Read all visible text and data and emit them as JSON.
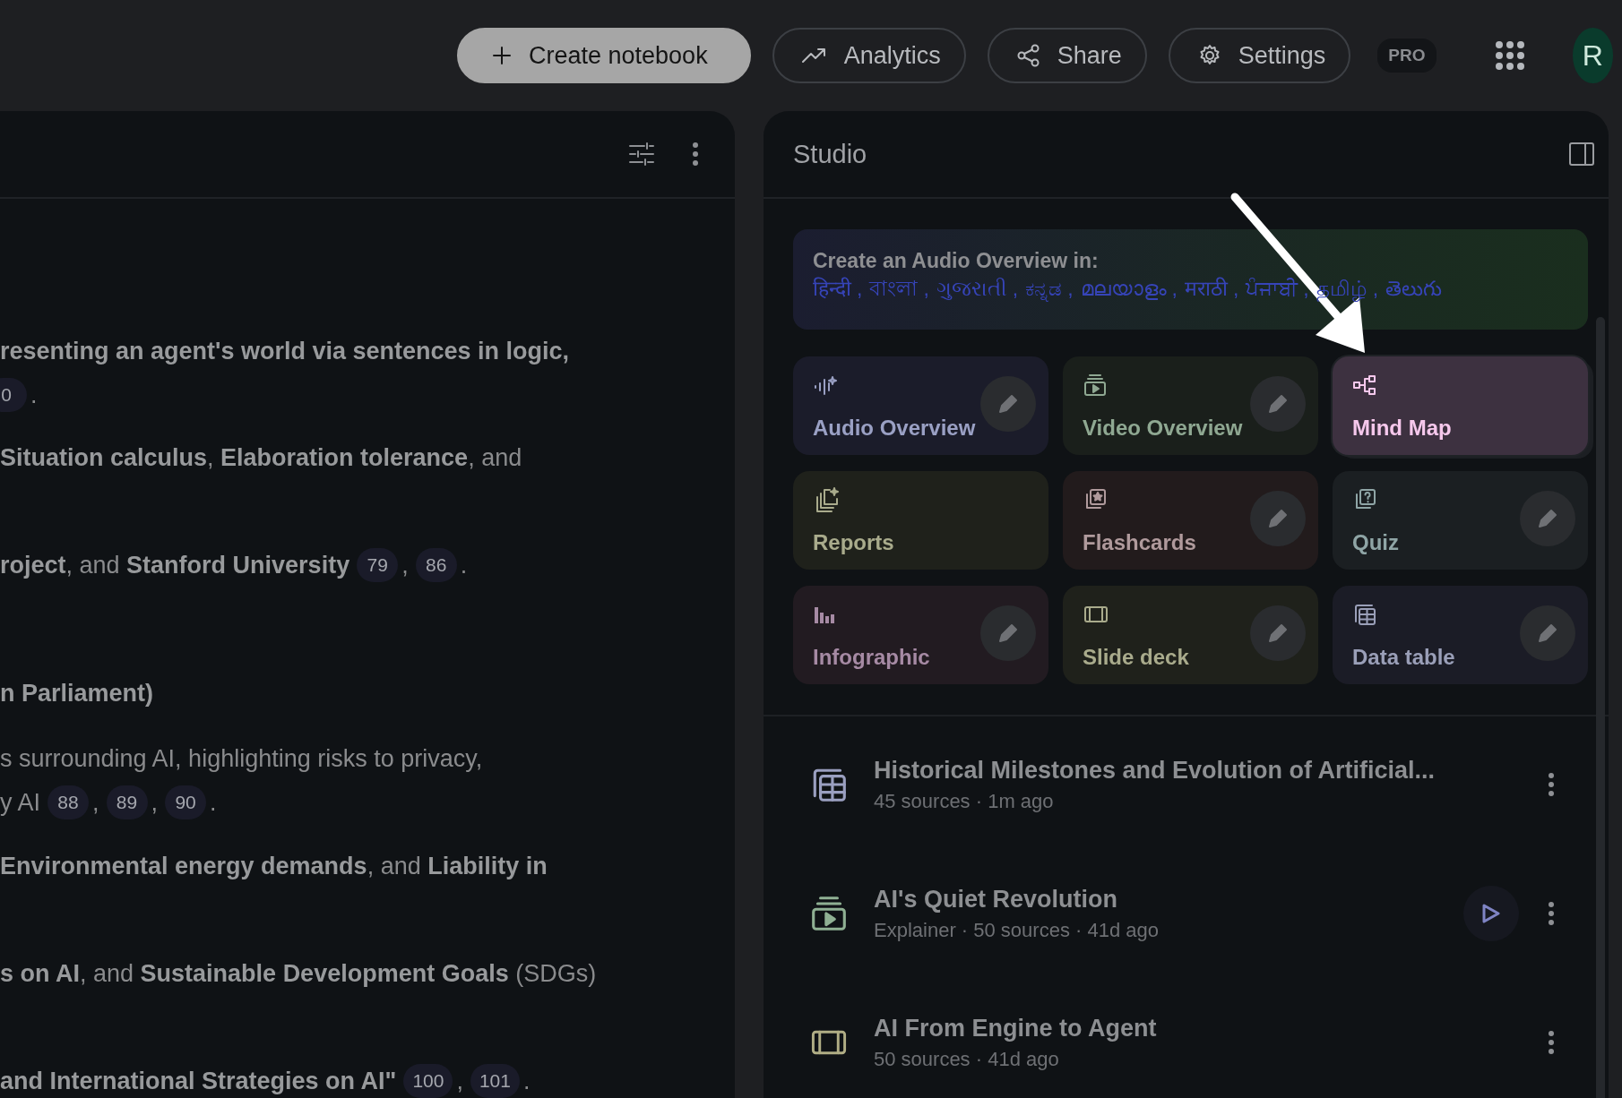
{
  "top_bar": {
    "buttons": [
      {
        "kind": "create",
        "label": "Create notebook"
      },
      {
        "kind": "analytics",
        "label": "Analytics"
      },
      {
        "kind": "share",
        "label": "Share"
      },
      {
        "kind": "settings",
        "label": "Settings"
      }
    ],
    "badge": "PRO",
    "avatar": "R"
  },
  "source_panel": {
    "lines": [
      {
        "segments": [
          {
            "kind": "text",
            "text": "**resenting an agent's world via sentences in logic,**"
          }
        ]
      },
      {
        "segments": [
          {
            "kind": "citation",
            "text": "0"
          },
          {
            "kind": "text",
            "text": "."
          }
        ]
      },
      {
        "segments": [
          {
            "kind": "text",
            "text": "**Situation calculus**, **Elaboration tolerance**, and"
          }
        ]
      },
      {
        "segments": [
          {
            "kind": "text",
            "text": "**roject**, and **Stanford University**"
          },
          {
            "kind": "citation",
            "text": "79"
          },
          {
            "kind": "text",
            "text": ","
          },
          {
            "kind": "citation",
            "text": "86"
          },
          {
            "kind": "text",
            "text": "."
          }
        ]
      },
      {
        "segments": [
          {
            "kind": "text",
            "text": "**n Parliament)**"
          }
        ]
      },
      {
        "segments": [
          {
            "kind": "text",
            "text": "s surrounding AI, highlighting risks to privacy,"
          }
        ]
      },
      {
        "segments": [
          {
            "kind": "text",
            "text": "y AI"
          },
          {
            "kind": "citation",
            "text": "88"
          },
          {
            "kind": "text",
            "text": ","
          },
          {
            "kind": "citation",
            "text": "89"
          },
          {
            "kind": "text",
            "text": ","
          },
          {
            "kind": "citation",
            "text": "90"
          },
          {
            "kind": "text",
            "text": "."
          }
        ]
      },
      {
        "segments": [
          {
            "kind": "text",
            "text": "**Environmental energy demands**, and **Liability in**"
          }
        ]
      },
      {
        "segments": [
          {
            "kind": "text",
            "text": "**s on AI**, and **Sustainable Development Goals** (SDGs)"
          }
        ]
      },
      {
        "segments": [
          {
            "kind": "text",
            "text": "**and International Strategies on AI\"**"
          },
          {
            "kind": "citation",
            "text": "100"
          },
          {
            "kind": "text",
            "text": ","
          },
          {
            "kind": "citation",
            "text": "101"
          },
          {
            "kind": "text",
            "text": "."
          }
        ]
      }
    ]
  },
  "studio": {
    "title": "Studio",
    "banner": {
      "prefix": "Create an Audio Overview in:",
      "items": [
        {
          "kind": "language",
          "text": "हिन्दी"
        },
        {
          "kind": "separator",
          "text": ","
        },
        {
          "kind": "language",
          "text": "বাংলা"
        },
        {
          "kind": "separator",
          "text": ","
        },
        {
          "kind": "language",
          "text": "ગુજરાતી"
        },
        {
          "kind": "separator",
          "text": ","
        },
        {
          "kind": "language",
          "text": "ಕನ್ನಡ"
        },
        {
          "kind": "separator",
          "text": ","
        },
        {
          "kind": "language",
          "text": "മലയാളം"
        },
        {
          "kind": "separator",
          "text": ","
        },
        {
          "kind": "language",
          "text": "मराठी"
        },
        {
          "kind": "separator",
          "text": ","
        },
        {
          "kind": "language",
          "text": "ਪੰਜਾਬੀ"
        },
        {
          "kind": "separator",
          "text": ","
        },
        {
          "kind": "language",
          "text": "தமிழ்"
        },
        {
          "kind": "separator",
          "text": ","
        },
        {
          "kind": "language",
          "text": "తెలుగు"
        }
      ]
    },
    "tools": [
      {
        "kind": "audio",
        "label": "Audio Overview",
        "color": "#9aa0c4",
        "editable": true,
        "selected": false
      },
      {
        "kind": "video",
        "label": "Video Overview",
        "color": "#8fa892",
        "editable": true,
        "selected": false
      },
      {
        "kind": "mindmap",
        "label": "Mind Map",
        "color": "#f6c8ec",
        "editable": false,
        "selected": true
      },
      {
        "kind": "reports",
        "label": "Reports",
        "color": "#a9ab8c",
        "editable": false,
        "selected": false
      },
      {
        "kind": "flashcards",
        "label": "Flashcards",
        "color": "#b09a9c",
        "editable": true,
        "selected": false
      },
      {
        "kind": "quiz",
        "label": "Quiz",
        "color": "#8fa5a6",
        "editable": true,
        "selected": false
      },
      {
        "kind": "infographic",
        "label": "Infographic",
        "color": "#a68aa4",
        "editable": true,
        "selected": false
      },
      {
        "kind": "slides",
        "label": "Slide deck",
        "color": "#a9ab8c",
        "editable": true,
        "selected": false
      },
      {
        "kind": "table",
        "label": "Data table",
        "color": "#9a9fb8",
        "editable": true,
        "selected": false
      }
    ],
    "outputs": [
      {
        "kind": "table",
        "title": "Historical Milestones and Evolution of Artificial...",
        "meta": "45 sources · 1m ago",
        "playable": false
      },
      {
        "kind": "video",
        "title": "AI's Quiet Revolution",
        "meta": "Explainer · 50 sources · 41d ago",
        "playable": true
      },
      {
        "kind": "slides",
        "title": "AI From Engine to Agent",
        "meta": "50 sources · 41d ago",
        "playable": false
      }
    ]
  }
}
